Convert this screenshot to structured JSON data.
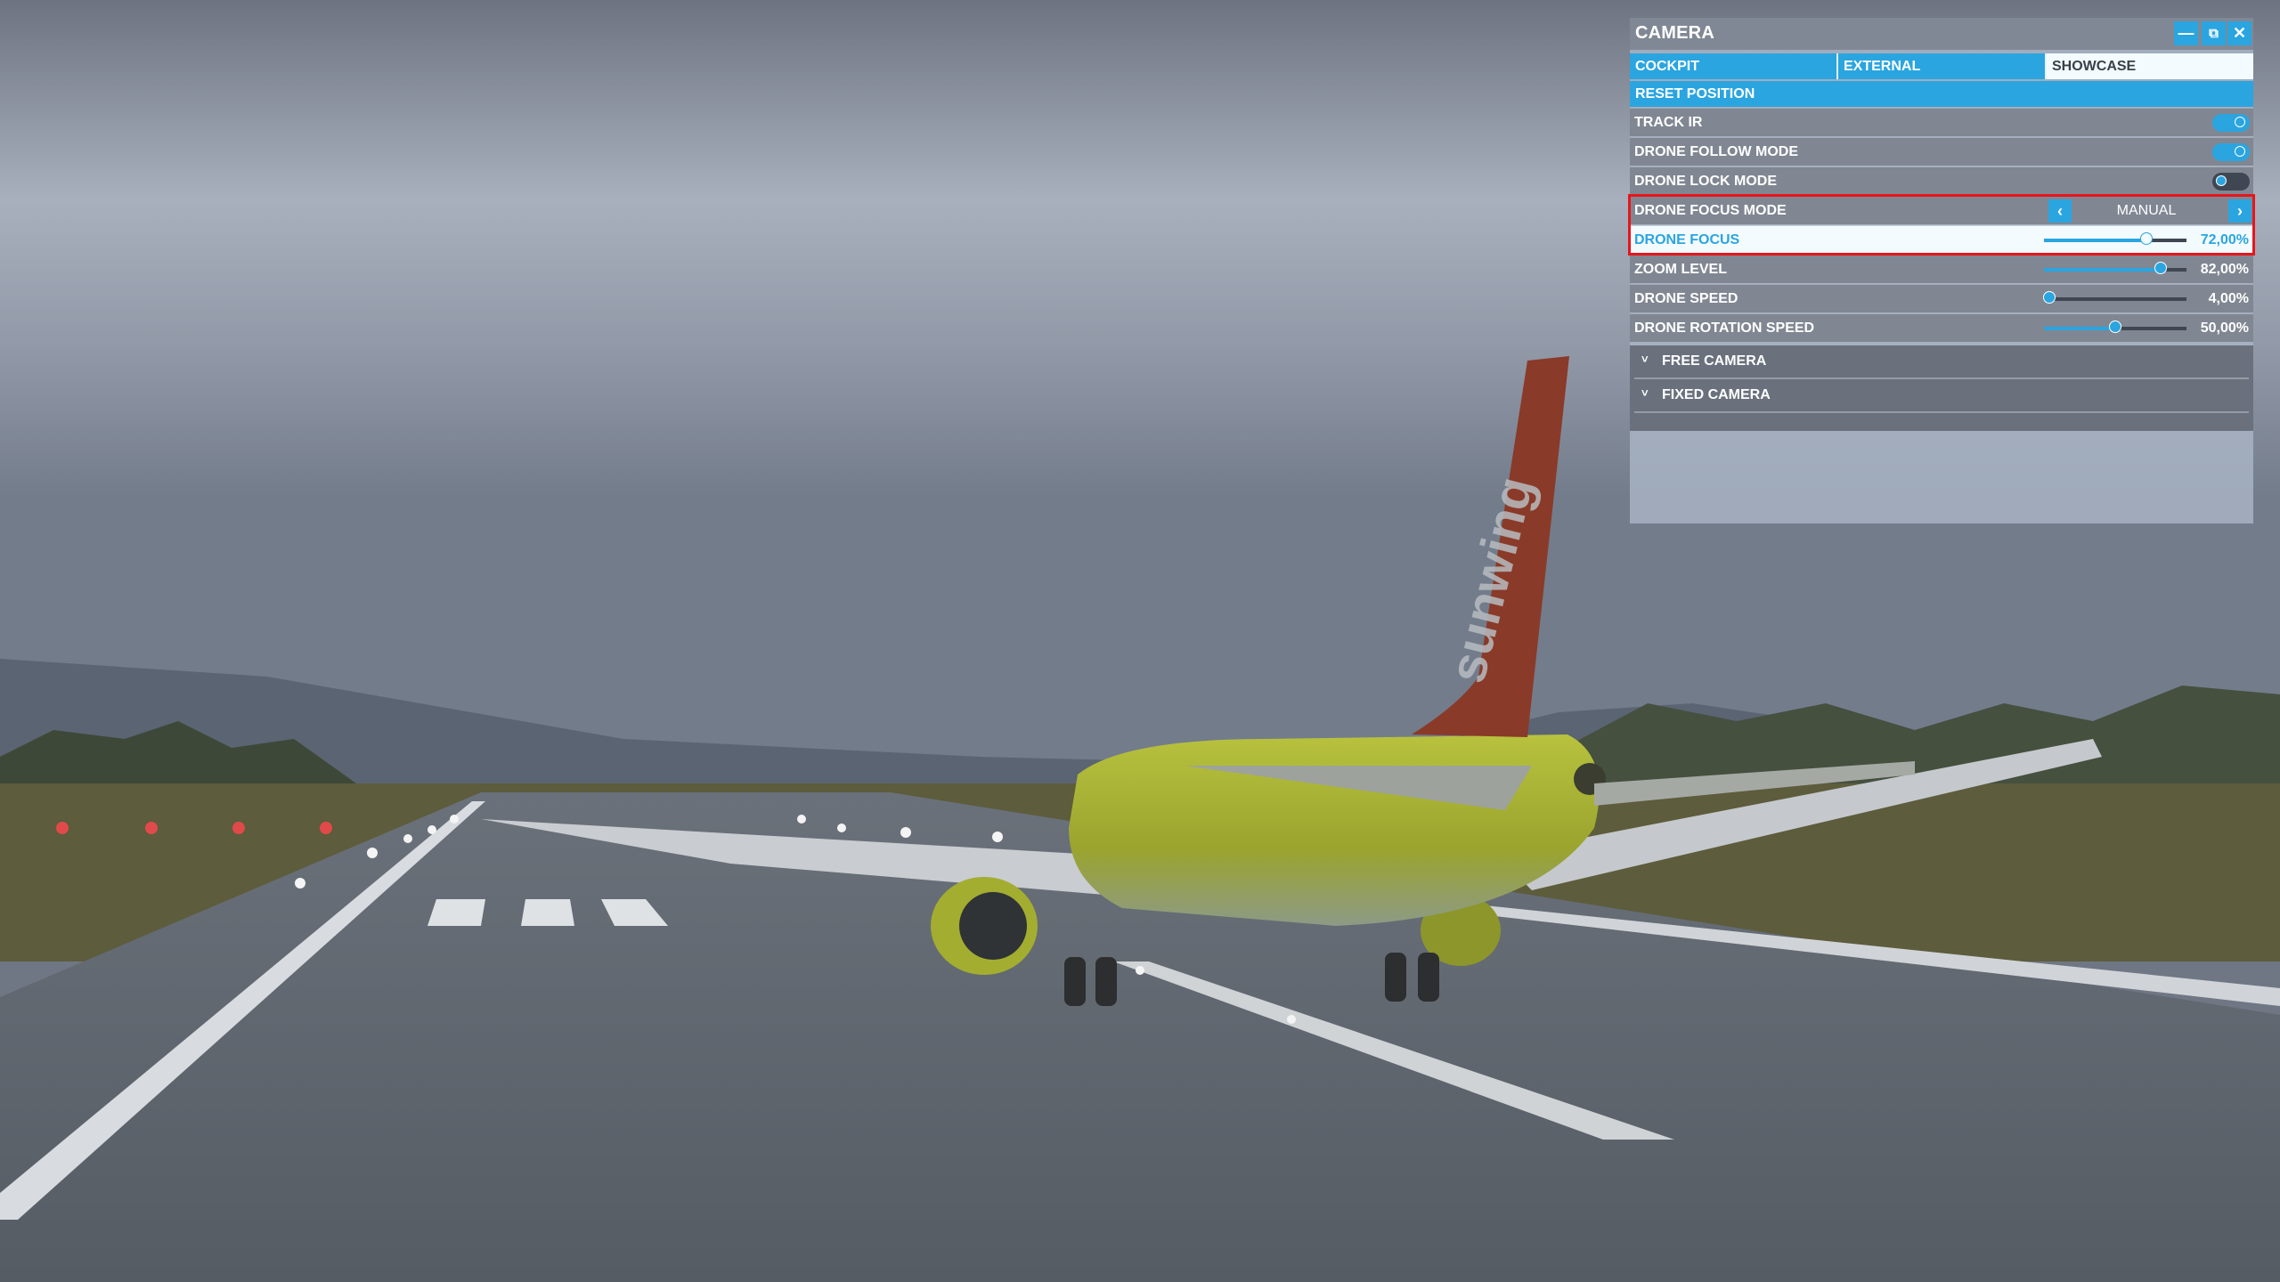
{
  "scene": {
    "description": "Flight simulator external drone view of a lime-green airliner on a wet runway under overcast sky",
    "tail_text": "sunwing",
    "colors": {
      "sky_top": "#7d8594",
      "sky_mid": "#a9b2c1",
      "ground": "#4f5660",
      "fuselage": "#a6b03a",
      "tail": "#8a3a28",
      "grass": "#5d5c3c"
    }
  },
  "camera_panel": {
    "title": "CAMERA",
    "window_buttons": {
      "minimize": "—",
      "popout": "⧉",
      "close": "✕"
    },
    "tabs": [
      {
        "label": "COCKPIT",
        "active": false
      },
      {
        "label": "EXTERNAL",
        "active": false
      },
      {
        "label": "SHOWCASE",
        "active": true
      }
    ],
    "reset_label": "RESET POSITION",
    "toggles": [
      {
        "label": "TRACK IR",
        "on": true
      },
      {
        "label": "DRONE FOLLOW MODE",
        "on": true
      },
      {
        "label": "DRONE LOCK MODE",
        "on": false
      }
    ],
    "focus_mode": {
      "label": "DRONE FOCUS MODE",
      "value": "MANUAL",
      "prev": "‹",
      "next": "›"
    },
    "sliders": [
      {
        "label": "DRONE FOCUS",
        "value": 72,
        "display": "72,00%",
        "selected": true
      },
      {
        "label": "ZOOM LEVEL",
        "value": 82,
        "display": "82,00%",
        "selected": false
      },
      {
        "label": "DRONE SPEED",
        "value": 4,
        "display": "4,00%",
        "selected": false
      },
      {
        "label": "DRONE ROTATION SPEED",
        "value": 50,
        "display": "50,00%",
        "selected": false
      }
    ],
    "sections": [
      {
        "label": "FREE CAMERA",
        "chevron": "˅"
      },
      {
        "label": "FIXED CAMERA",
        "chevron": "˅"
      }
    ],
    "accent_color": "#2aa5e0",
    "highlight_color": "#e8151b"
  }
}
